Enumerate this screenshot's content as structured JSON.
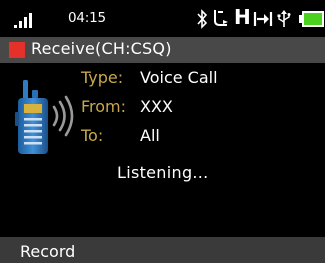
{
  "status_bar": {
    "time": "04:15",
    "signal_icon": "signal-strength-icon",
    "icons": [
      "bluetooth-icon",
      "gps-icon",
      "hsdpa-h-icon",
      "call-forward-icon",
      "usb-icon",
      "battery-icon"
    ],
    "network_letter": "H",
    "battery_color": "#4cd21e"
  },
  "title_bar": {
    "title": "Receive(CH:CSQ)",
    "indicator_color": "#e4322b"
  },
  "call_info": {
    "icon": "walkie-talkie-icon",
    "type_label": "Type:",
    "type_value": "Voice Call",
    "from_label": "From:",
    "from_value": "XXX",
    "to_label": "To:",
    "to_value": "All",
    "label_color": "#c8a94a",
    "status": "Listening..."
  },
  "softkeys": {
    "left": "Record"
  }
}
